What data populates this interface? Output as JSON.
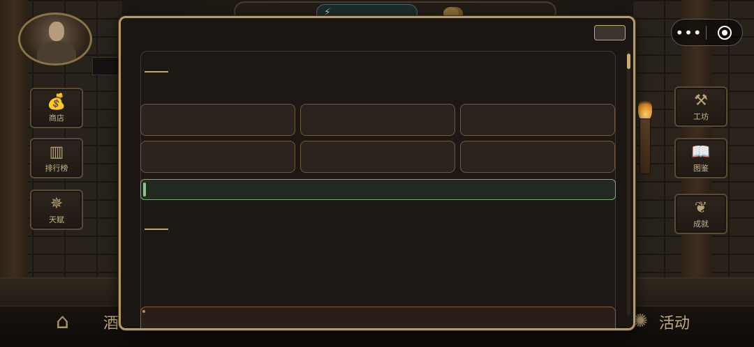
{
  "game": {
    "side_menu_left": [
      {
        "label": "商店",
        "icon": "moneybag-icon"
      },
      {
        "label": "排行榜",
        "icon": "podium-icon"
      },
      {
        "label": "天赋",
        "icon": "star-icon"
      }
    ],
    "side_menu_right": [
      {
        "label": "工坊",
        "icon": "hammer-icon"
      },
      {
        "label": "图鉴",
        "icon": "book-icon"
      },
      {
        "label": "成就",
        "icon": "laurel-icon"
      }
    ],
    "bottom_nav": {
      "tavern_label": "酒",
      "event_label": "活动"
    },
    "energy_icon": "lightning-icon"
  },
  "capsule": {
    "more_glyph": "•••"
  },
  "modal": {
    "close_label": "",
    "section_1_title": "",
    "section_2_title": "",
    "options": [
      "",
      "",
      "",
      "",
      "",
      ""
    ],
    "highlight_text": "",
    "bottom_text": ""
  },
  "colors": {
    "modal_border": "#b69b62",
    "highlight_border": "#7fa57d",
    "bottom_border": "#8a5b46"
  }
}
